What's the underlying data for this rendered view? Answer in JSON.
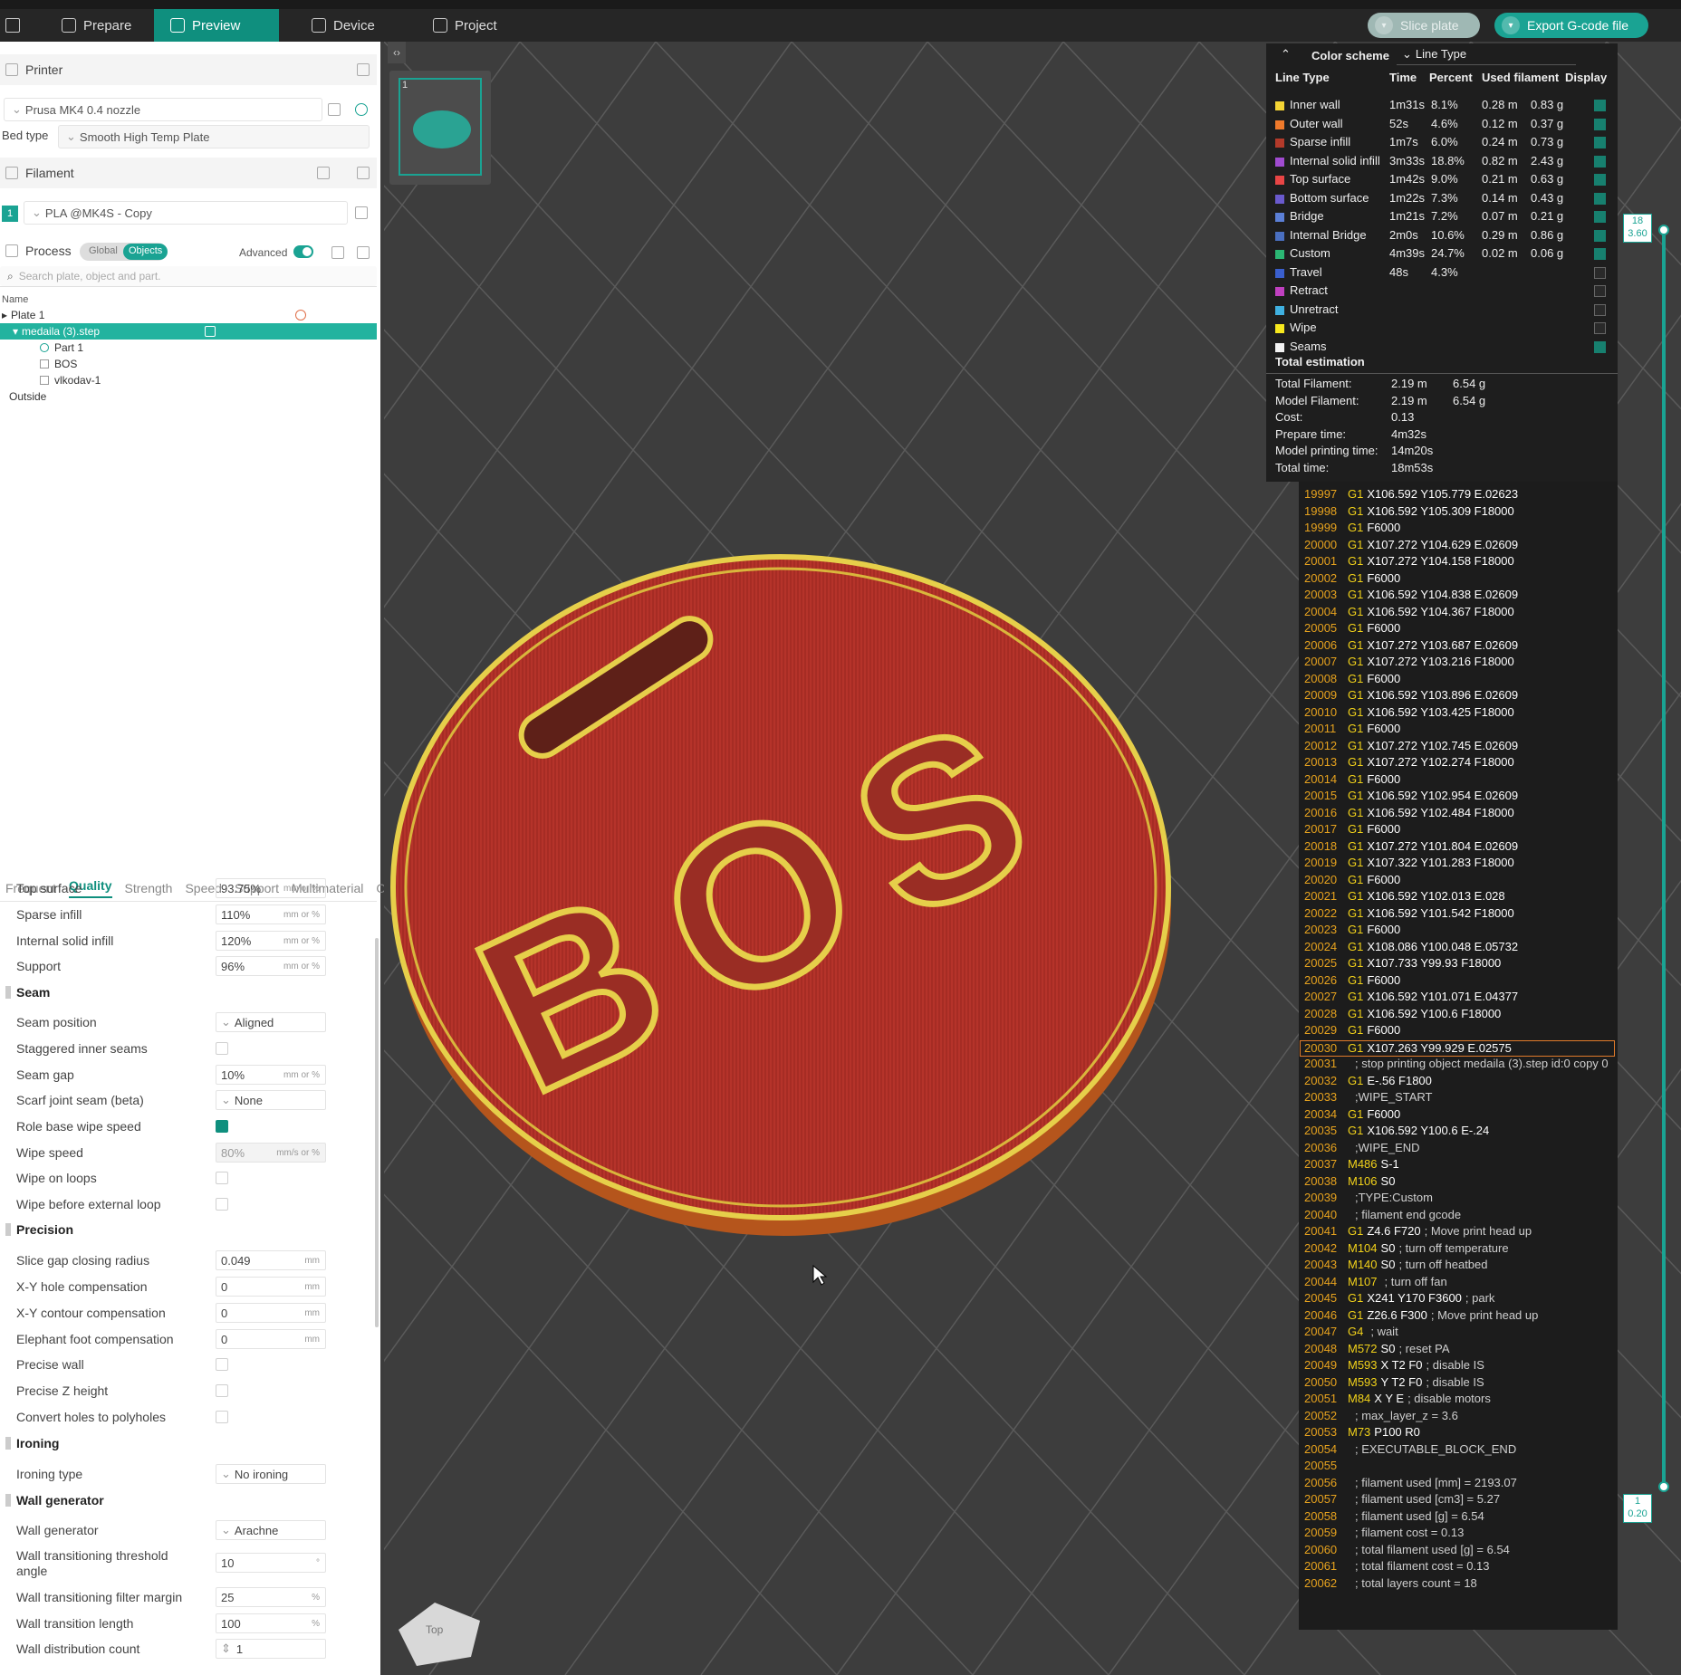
{
  "tabs": [
    {
      "label": "Prepare"
    },
    {
      "label": "Preview"
    },
    {
      "label": "Device"
    },
    {
      "label": "Project"
    }
  ],
  "top_buttons": {
    "slice": "Slice plate",
    "export": "Export G-code file"
  },
  "printer": {
    "title": "Printer",
    "name": "Prusa MK4 0.4 nozzle",
    "bed_label": "Bed type",
    "bed_value": "Smooth High Temp Plate"
  },
  "filament": {
    "title": "Filament",
    "index": "1",
    "name": "PLA @MK4S - Copy"
  },
  "process": {
    "title": "Process",
    "global": "Global",
    "objects": "Objects",
    "advanced": "Advanced",
    "search_placeholder": "Search plate, object and part."
  },
  "tree": {
    "header": "Name",
    "rows": [
      "Plate 1",
      "medaila (3).step",
      "Part 1",
      "BOS",
      "vlkodav-1",
      "Outside"
    ]
  },
  "quality_tabs": [
    "Frequent",
    "Quality",
    "Strength",
    "Speed",
    "Support",
    "Multimaterial",
    "O"
  ],
  "options": {
    "top_surface": {
      "label": "Top surface",
      "value": "93.75%",
      "unit": "mm or %"
    },
    "sparse_infill": {
      "label": "Sparse infill",
      "value": "110%",
      "unit": "mm or %"
    },
    "internal_solid": {
      "label": "Internal solid infill",
      "value": "120%",
      "unit": "mm or %"
    },
    "support": {
      "label": "Support",
      "value": "96%",
      "unit": "mm or %"
    },
    "seam_group": "Seam",
    "seam_position": {
      "label": "Seam position",
      "value": "Aligned"
    },
    "staggered": {
      "label": "Staggered inner seams"
    },
    "seam_gap": {
      "label": "Seam gap",
      "value": "10%",
      "unit": "mm or %"
    },
    "scarf": {
      "label": "Scarf joint seam (beta)",
      "value": "None"
    },
    "role_wipe": {
      "label": "Role base wipe speed"
    },
    "wipe_speed": {
      "label": "Wipe speed",
      "value": "80%",
      "unit": "mm/s or %"
    },
    "wipe_loops": {
      "label": "Wipe on loops"
    },
    "wipe_before": {
      "label": "Wipe before external loop"
    },
    "precision_group": "Precision",
    "slice_gap": {
      "label": "Slice gap closing radius",
      "value": "0.049",
      "unit": "mm"
    },
    "xy_hole": {
      "label": "X-Y hole compensation",
      "value": "0",
      "unit": "mm"
    },
    "xy_contour": {
      "label": "X-Y contour compensation",
      "value": "0",
      "unit": "mm"
    },
    "elephant": {
      "label": "Elephant foot compensation",
      "value": "0",
      "unit": "mm"
    },
    "precise_wall": {
      "label": "Precise wall"
    },
    "precise_z": {
      "label": "Precise Z height"
    },
    "convert_holes": {
      "label": "Convert holes to polyholes"
    },
    "ironing_group": "Ironing",
    "ironing_type": {
      "label": "Ironing type",
      "value": "No ironing"
    },
    "wallgen_group": "Wall generator",
    "wall_generator": {
      "label": "Wall generator",
      "value": "Arachne"
    },
    "wall_threshold": {
      "label1": "Wall transitioning threshold",
      "label2": "angle",
      "value": "10",
      "unit": "°"
    },
    "wall_filter": {
      "label": "Wall transitioning filter margin",
      "value": "25",
      "unit": "%"
    },
    "wall_length": {
      "label": "Wall transition length",
      "value": "100",
      "unit": "%"
    },
    "wall_count": {
      "label": "Wall distribution count",
      "value": "1"
    }
  },
  "legend": {
    "title": "Color scheme",
    "scheme": "Line Type",
    "headers": [
      "Line Type",
      "Time",
      "Percent",
      "Used filament",
      "Display"
    ],
    "rows": [
      {
        "name": "Inner wall",
        "color": "#f5d535",
        "time": "1m31s",
        "pct": "8.1%",
        "len": "0.28 m",
        "wt": "0.83 g",
        "on": true
      },
      {
        "name": "Outer wall",
        "color": "#f07a2b",
        "time": "52s",
        "pct": "4.6%",
        "len": "0.12 m",
        "wt": "0.37 g",
        "on": true
      },
      {
        "name": "Sparse infill",
        "color": "#b33a2a",
        "time": "1m7s",
        "pct": "6.0%",
        "len": "0.24 m",
        "wt": "0.73 g",
        "on": true
      },
      {
        "name": "Internal solid infill",
        "color": "#a04bd0",
        "time": "3m33s",
        "pct": "18.8%",
        "len": "0.82 m",
        "wt": "2.43 g",
        "on": true
      },
      {
        "name": "Top surface",
        "color": "#e84545",
        "time": "1m42s",
        "pct": "9.0%",
        "len": "0.21 m",
        "wt": "0.63 g",
        "on": true
      },
      {
        "name": "Bottom surface",
        "color": "#6a5acd",
        "time": "1m22s",
        "pct": "7.3%",
        "len": "0.14 m",
        "wt": "0.43 g",
        "on": true
      },
      {
        "name": "Bridge",
        "color": "#5b7fd6",
        "time": "1m21s",
        "pct": "7.2%",
        "len": "0.07 m",
        "wt": "0.21 g",
        "on": true
      },
      {
        "name": "Internal Bridge",
        "color": "#4a6fc0",
        "time": "2m0s",
        "pct": "10.6%",
        "len": "0.29 m",
        "wt": "0.86 g",
        "on": true
      },
      {
        "name": "Custom",
        "color": "#2bb673",
        "time": "4m39s",
        "pct": "24.7%",
        "len": "0.02 m",
        "wt": "0.06 g",
        "on": true
      },
      {
        "name": "Travel",
        "color": "#3a5fcd",
        "time": "48s",
        "pct": "4.3%",
        "len": "",
        "wt": "",
        "on": false
      },
      {
        "name": "Retract",
        "color": "#c040c0",
        "time": "",
        "pct": "",
        "len": "",
        "wt": "",
        "on": false
      },
      {
        "name": "Unretract",
        "color": "#3fb0e0",
        "time": "",
        "pct": "",
        "len": "",
        "wt": "",
        "on": false
      },
      {
        "name": "Wipe",
        "color": "#f7e81e",
        "time": "",
        "pct": "",
        "len": "",
        "wt": "",
        "on": false
      },
      {
        "name": "Seams",
        "color": "#f2f2f2",
        "time": "",
        "pct": "",
        "len": "",
        "wt": "",
        "on": true
      }
    ],
    "total_title": "Total estimation",
    "totals": [
      {
        "k": "Total Filament:",
        "v": "2.19 m",
        "v2": "6.54 g"
      },
      {
        "k": "Model Filament:",
        "v": "2.19 m",
        "v2": "6.54 g"
      },
      {
        "k": "Cost:",
        "v": "0.13",
        "v2": ""
      },
      {
        "k": "Prepare time:",
        "v": "4m32s",
        "v2": ""
      },
      {
        "k": "Model printing time:",
        "v": "14m20s",
        "v2": ""
      },
      {
        "k": "Total time:",
        "v": "18m53s",
        "v2": ""
      }
    ]
  },
  "slider": {
    "top_layer": "18",
    "top_height": "3.60",
    "bottom_layer": "1",
    "bottom_height": "0.20"
  },
  "plate_thumb": "1",
  "gcode": [
    {
      "n": "19997",
      "c": "G1",
      "r": "X106.592 Y105.779 E.02623",
      "cm": ""
    },
    {
      "n": "19998",
      "c": "G1",
      "r": "X106.592 Y105.309 F18000",
      "cm": ""
    },
    {
      "n": "19999",
      "c": "G1",
      "r": "F6000",
      "cm": ""
    },
    {
      "n": "20000",
      "c": "G1",
      "r": "X107.272 Y104.629 E.02609",
      "cm": ""
    },
    {
      "n": "20001",
      "c": "G1",
      "r": "X107.272 Y104.158 F18000",
      "cm": ""
    },
    {
      "n": "20002",
      "c": "G1",
      "r": "F6000",
      "cm": ""
    },
    {
      "n": "20003",
      "c": "G1",
      "r": "X106.592 Y104.838 E.02609",
      "cm": ""
    },
    {
      "n": "20004",
      "c": "G1",
      "r": "X106.592 Y104.367 F18000",
      "cm": ""
    },
    {
      "n": "20005",
      "c": "G1",
      "r": "F6000",
      "cm": ""
    },
    {
      "n": "20006",
      "c": "G1",
      "r": "X107.272 Y103.687 E.02609",
      "cm": ""
    },
    {
      "n": "20007",
      "c": "G1",
      "r": "X107.272 Y103.216 F18000",
      "cm": ""
    },
    {
      "n": "20008",
      "c": "G1",
      "r": "F6000",
      "cm": ""
    },
    {
      "n": "20009",
      "c": "G1",
      "r": "X106.592 Y103.896 E.02609",
      "cm": ""
    },
    {
      "n": "20010",
      "c": "G1",
      "r": "X106.592 Y103.425 F18000",
      "cm": ""
    },
    {
      "n": "20011",
      "c": "G1",
      "r": "F6000",
      "cm": ""
    },
    {
      "n": "20012",
      "c": "G1",
      "r": "X107.272 Y102.745 E.02609",
      "cm": ""
    },
    {
      "n": "20013",
      "c": "G1",
      "r": "X107.272 Y102.274 F18000",
      "cm": ""
    },
    {
      "n": "20014",
      "c": "G1",
      "r": "F6000",
      "cm": ""
    },
    {
      "n": "20015",
      "c": "G1",
      "r": "X106.592 Y102.954 E.02609",
      "cm": ""
    },
    {
      "n": "20016",
      "c": "G1",
      "r": "X106.592 Y102.484 F18000",
      "cm": ""
    },
    {
      "n": "20017",
      "c": "G1",
      "r": "F6000",
      "cm": ""
    },
    {
      "n": "20018",
      "c": "G1",
      "r": "X107.272 Y101.804 E.02609",
      "cm": ""
    },
    {
      "n": "20019",
      "c": "G1",
      "r": "X107.322 Y101.283 F18000",
      "cm": ""
    },
    {
      "n": "20020",
      "c": "G1",
      "r": "F6000",
      "cm": ""
    },
    {
      "n": "20021",
      "c": "G1",
      "r": "X106.592 Y102.013 E.028",
      "cm": ""
    },
    {
      "n": "20022",
      "c": "G1",
      "r": "X106.592 Y101.542 F18000",
      "cm": ""
    },
    {
      "n": "20023",
      "c": "G1",
      "r": "F6000",
      "cm": ""
    },
    {
      "n": "20024",
      "c": "G1",
      "r": "X108.086 Y100.048 E.05732",
      "cm": ""
    },
    {
      "n": "20025",
      "c": "G1",
      "r": "X107.733 Y99.93 F18000",
      "cm": ""
    },
    {
      "n": "20026",
      "c": "G1",
      "r": "F6000",
      "cm": ""
    },
    {
      "n": "20027",
      "c": "G1",
      "r": "X106.592 Y101.071 E.04377",
      "cm": ""
    },
    {
      "n": "20028",
      "c": "G1",
      "r": "X106.592 Y100.6 F18000",
      "cm": ""
    },
    {
      "n": "20029",
      "c": "G1",
      "r": "F6000",
      "cm": ""
    },
    {
      "n": "20030",
      "c": "G1",
      "r": "X107.263 Y99.929 E.02575",
      "cm": ""
    },
    {
      "n": "20031",
      "c": "",
      "r": "",
      "cm": "; stop printing object medaila (3).step id:0 copy 0"
    },
    {
      "n": "20032",
      "c": "G1",
      "r": "E-.56 F1800",
      "cm": ""
    },
    {
      "n": "20033",
      "c": "",
      "r": "",
      "cm": ";WIPE_START"
    },
    {
      "n": "20034",
      "c": "G1",
      "r": "F6000",
      "cm": ""
    },
    {
      "n": "20035",
      "c": "G1",
      "r": "X106.592 Y100.6 E-.24",
      "cm": ""
    },
    {
      "n": "20036",
      "c": "",
      "r": "",
      "cm": ";WIPE_END"
    },
    {
      "n": "20037",
      "c": "M486",
      "r": "S-1",
      "cm": ""
    },
    {
      "n": "20038",
      "c": "M106",
      "r": "S0",
      "cm": ""
    },
    {
      "n": "20039",
      "c": "",
      "r": "",
      "cm": ";TYPE:Custom"
    },
    {
      "n": "20040",
      "c": "",
      "r": "",
      "cm": "; filament end gcode"
    },
    {
      "n": "20041",
      "c": "G1",
      "r": "Z4.6 F720",
      "cm": "; Move print head up"
    },
    {
      "n": "20042",
      "c": "M104",
      "r": "S0",
      "cm": "; turn off temperature"
    },
    {
      "n": "20043",
      "c": "M140",
      "r": "S0",
      "cm": "; turn off heatbed"
    },
    {
      "n": "20044",
      "c": "M107",
      "r": "",
      "cm": "; turn off fan"
    },
    {
      "n": "20045",
      "c": "G1",
      "r": "X241 Y170 F3600",
      "cm": "; park"
    },
    {
      "n": "20046",
      "c": "G1",
      "r": "Z26.6 F300",
      "cm": "; Move print head up"
    },
    {
      "n": "20047",
      "c": "G4",
      "r": "",
      "cm": "; wait"
    },
    {
      "n": "20048",
      "c": "M572",
      "r": "S0",
      "cm": "; reset PA"
    },
    {
      "n": "20049",
      "c": "M593",
      "r": "X T2 F0",
      "cm": "; disable IS"
    },
    {
      "n": "20050",
      "c": "M593",
      "r": "Y T2 F0",
      "cm": "; disable IS"
    },
    {
      "n": "20051",
      "c": "M84",
      "r": "X Y E",
      "cm": "; disable motors"
    },
    {
      "n": "20052",
      "c": "",
      "r": "",
      "cm": "; max_layer_z = 3.6"
    },
    {
      "n": "20053",
      "c": "M73",
      "r": "P100 R0",
      "cm": ""
    },
    {
      "n": "20054",
      "c": "",
      "r": "",
      "cm": "; EXECUTABLE_BLOCK_END"
    },
    {
      "n": "20055",
      "c": "",
      "r": "",
      "cm": ""
    },
    {
      "n": "20056",
      "c": "",
      "r": "",
      "cm": "; filament used [mm] = 2193.07"
    },
    {
      "n": "20057",
      "c": "",
      "r": "",
      "cm": "; filament used [cm3] = 5.27"
    },
    {
      "n": "20058",
      "c": "",
      "r": "",
      "cm": "; filament used [g] = 6.54"
    },
    {
      "n": "20059",
      "c": "",
      "r": "",
      "cm": "; filament cost = 0.13"
    },
    {
      "n": "20060",
      "c": "",
      "r": "",
      "cm": "; total filament used [g] = 6.54"
    },
    {
      "n": "20061",
      "c": "",
      "r": "",
      "cm": "; total filament cost = 0.13"
    },
    {
      "n": "20062",
      "c": "",
      "r": "",
      "cm": "; total layers count = 18"
    }
  ],
  "model_text": "BOS",
  "cube_label": "Top",
  "colors": {
    "accent": "#0f8f7e",
    "plate_red": "#b5332a",
    "wall_yellow": "#e6cf4a",
    "rim_orange": "#c8641f"
  }
}
